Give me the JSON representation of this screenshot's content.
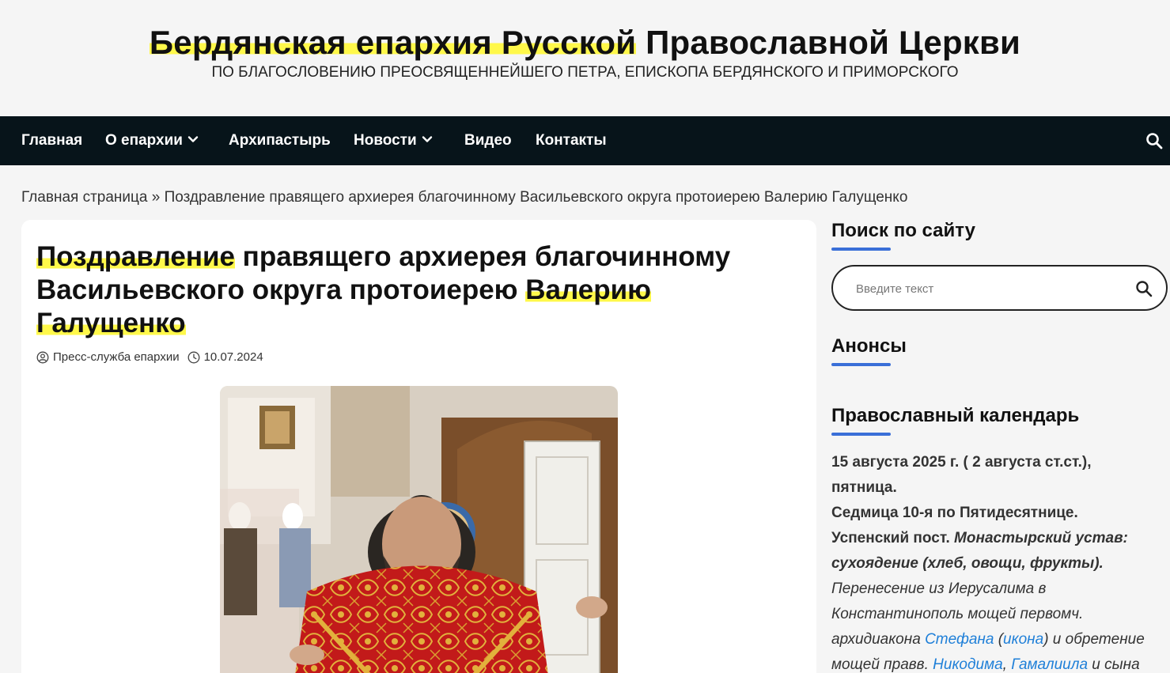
{
  "header": {
    "title_part1": "Бердянская епархия Русской",
    "title_part2": " Православной Церкви",
    "tagline": "ПО БЛАГОСЛОВЕНИЮ ПРЕОСВЯЩЕННЕЙШЕГО ПЕТРА, ЕПИСКОПА БЕРДЯНСКОГО И ПРИМОРСКОГО"
  },
  "nav": {
    "items": [
      {
        "label": "Главная"
      },
      {
        "label": "О епархии"
      },
      {
        "label": "Архипастырь"
      },
      {
        "label": "Новости"
      },
      {
        "label": "Видео"
      },
      {
        "label": "Контакты"
      }
    ],
    "search_icon": "search-icon"
  },
  "breadcrumb": {
    "home": "Главная страница",
    "separator": " » ",
    "current": "Поздравление правящего архиерея благочинному Васильевского округа протоиерею Валерию Галущенко"
  },
  "article": {
    "title_w1": "Поздравление",
    "title_mid": " правящего архиерея благочинному Васильевского округа протоиерею ",
    "title_w2": "Валерию",
    "title_w3": "Галущенко",
    "author": "Пресс-служба епархии",
    "date": "10.07.2024",
    "author_icon": "user-circle-icon",
    "date_icon": "clock-icon"
  },
  "sidebar": {
    "search_title": "Поиск по сайту",
    "search_placeholder": "Введите текст",
    "announce_title": "Анонсы",
    "calendar_title": "Православный календарь",
    "calendar": {
      "date": "15 августа 2025 г. ( 2 августа ст.ст.),",
      "weekday": "пятница.",
      "week": "Седмица 10-я по Пятидесятнице.",
      "fast": "Успенский пост.",
      "fast_rule": "Монастырский устав: сухоядение (хлеб, овощи, фрукты).",
      "feast_1": "Перенесение из Иерусалима в Константинополь мощей первомч. архидиакона",
      "link_stefan": "Стефана",
      "paren_open": " (",
      "link_icon": "икона",
      "feast_2": ") и обретение мощей правв.",
      "link_nikodim": "Никодима",
      "comma": ", ",
      "link_gamaliil": "Гамалиила",
      "feast_3": " и сына"
    }
  },
  "colors": {
    "nav_bg": "#07141a",
    "highlight": "#fff84a",
    "accent_bar": "#3a6fd8",
    "link": "#1e7fd8"
  }
}
